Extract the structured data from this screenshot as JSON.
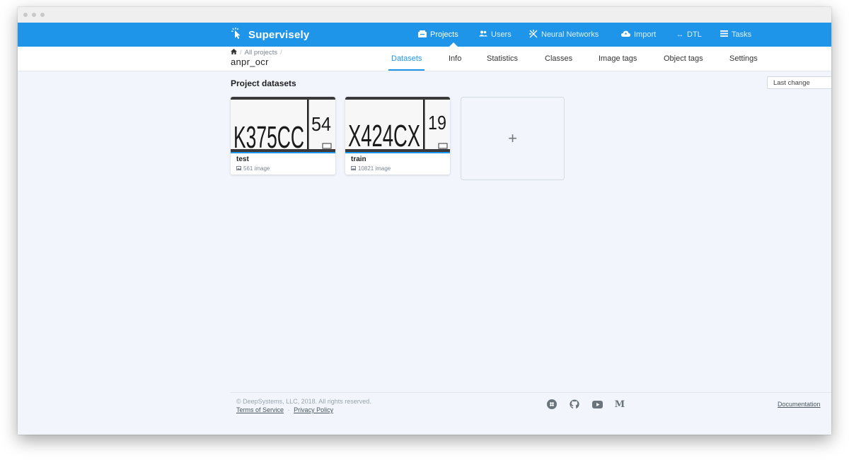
{
  "app": {
    "name": "Supervisely"
  },
  "topnav": {
    "items": [
      {
        "label": "Projects",
        "icon": "projects-icon",
        "active": true
      },
      {
        "label": "Users",
        "icon": "users-icon"
      },
      {
        "label": "Neural Networks",
        "icon": "neural-networks-icon"
      },
      {
        "label": "Import",
        "icon": "cloud-upload-icon"
      },
      {
        "label": "DTL",
        "icon": "arrows-icon"
      },
      {
        "label": "Tasks",
        "icon": "list-icon"
      }
    ]
  },
  "breadcrumb": {
    "home_icon": "home-icon",
    "separator": "/",
    "parent": "All projects",
    "trailing_separator": "/"
  },
  "project": {
    "name": "anpr_ocr"
  },
  "tabs": [
    {
      "label": "Datasets",
      "active": true
    },
    {
      "label": "Info"
    },
    {
      "label": "Statistics"
    },
    {
      "label": "Classes"
    },
    {
      "label": "Image tags"
    },
    {
      "label": "Object tags"
    },
    {
      "label": "Settings"
    }
  ],
  "main": {
    "section_title": "Project datasets",
    "sort": {
      "selected": "Last change"
    },
    "datasets": [
      {
        "name": "test",
        "count": "561 image",
        "plate_text": "K375CC",
        "region": "54"
      },
      {
        "name": "train",
        "count": "10821 image",
        "plate_text": "X424CX",
        "region": "19"
      }
    ],
    "add_label": "+"
  },
  "footer": {
    "copyright": "© DeepSystems, LLC, 2018. All rights reserved.",
    "terms": "Terms of Service",
    "separator": "·",
    "privacy": "Privacy Policy",
    "documentation": "Documentation",
    "socials": [
      "slack-icon",
      "github-icon",
      "youtube-icon",
      "medium-icon"
    ],
    "medium_letter": "M"
  },
  "colors": {
    "accent": "#1e95e8",
    "background": "#f2f6fc"
  }
}
